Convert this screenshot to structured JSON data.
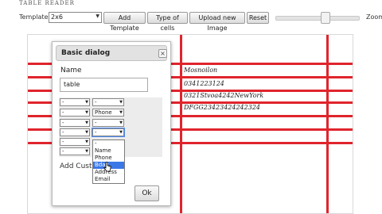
{
  "app": {
    "title": "TABLE READER"
  },
  "toolbar": {
    "templates_label": "Templates:",
    "template_value": "2x6",
    "add_template": "Add Template",
    "type_of_cells": "Type of cells",
    "upload_image": "Upload new Image",
    "reset": "Reset",
    "zoom_label": "Zoom",
    "zoom_level": 0.55
  },
  "canvas": {
    "cells": [
      "Mosnoilon",
      "0341223124",
      "0321Stvoa4242NewYork",
      "DFGG23423424242324"
    ]
  },
  "dialog": {
    "title": "Basic dialog",
    "close_symbol": "×",
    "name_label": "Name",
    "name_value": "table",
    "rows": [
      {
        "left": "-",
        "right": "-"
      },
      {
        "left": "-",
        "right": "Phone"
      },
      {
        "left": "-",
        "right": "-"
      },
      {
        "left": "-",
        "right": "-"
      },
      {
        "left": "-",
        "right": ""
      },
      {
        "left": "-",
        "right": ""
      }
    ],
    "dropdown_options": [
      "-",
      "Name",
      "Phone",
      "Bday",
      "Address",
      "Email"
    ],
    "dropdown_selected_index": 3,
    "add_custom": "Add Custom",
    "ok": "Ok"
  }
}
